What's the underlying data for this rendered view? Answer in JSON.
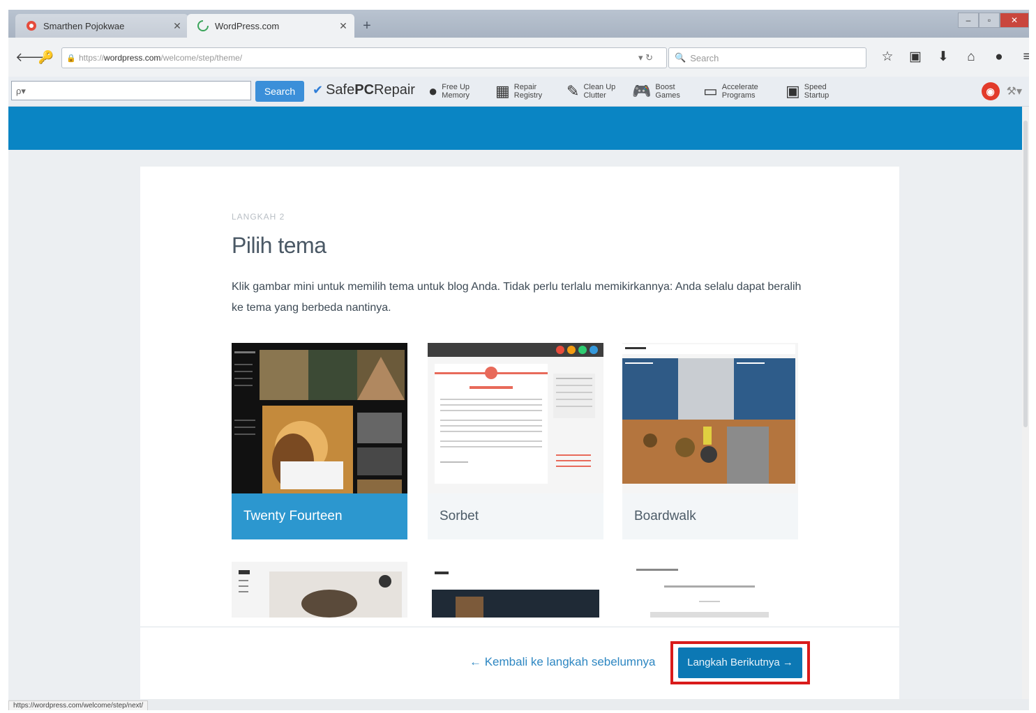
{
  "tabs": [
    {
      "title": "Smarthen Pojokwae",
      "active": false
    },
    {
      "title": "WordPress.com",
      "active": true
    }
  ],
  "url": {
    "prefix": "https://",
    "domain": "wordpress.com",
    "path": "/welcome/step/theme/"
  },
  "search_placeholder": "Search",
  "toolbar": {
    "search_field_value": "ρ▾",
    "search_button": "Search",
    "brand_safe": "Safe",
    "brand_pc": "PC",
    "brand_repair": "Repair",
    "tools": [
      {
        "line1": "Free Up",
        "line2": "Memory"
      },
      {
        "line1": "Repair",
        "line2": "Registry"
      },
      {
        "line1": "Clean Up",
        "line2": "Clutter"
      },
      {
        "line1": "Boost",
        "line2": "Games"
      },
      {
        "line1": "Accelerate",
        "line2": "Programs"
      },
      {
        "line1": "Speed",
        "line2": "Startup"
      }
    ]
  },
  "page": {
    "step_label": "LANGKAH 2",
    "title": "Pilih tema",
    "description": "Klik gambar mini untuk memilih tema untuk blog Anda. Tidak perlu terlalu memikirkannya: Anda selalu dapat beralih ke tema yang berbeda nantinya.",
    "themes": [
      {
        "name": "Twenty Fourteen",
        "selected": true
      },
      {
        "name": "Sorbet",
        "selected": false
      },
      {
        "name": "Boardwalk",
        "selected": false
      }
    ],
    "back_link": "← Kembali ke langkah sebelumnya",
    "next_button": "Langkah Berikutnya →"
  },
  "status_url": "https://wordpress.com/welcome/step/next/",
  "colors": {
    "banner": "#0a85c4",
    "selected_theme": "#2c97cf",
    "next_button": "#0c78b4",
    "highlight": "#d91b1b"
  }
}
